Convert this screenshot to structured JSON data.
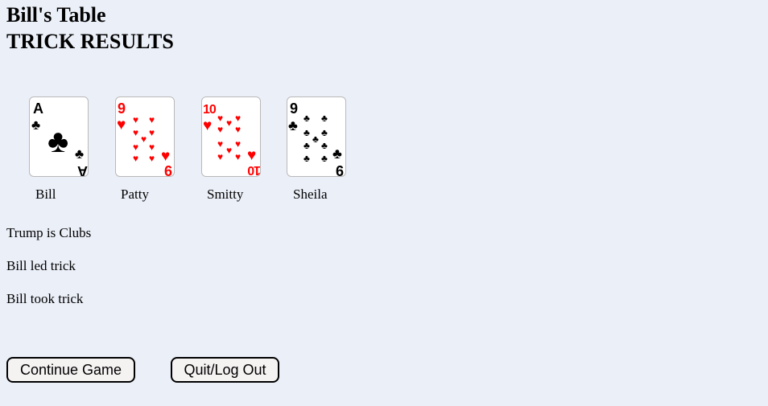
{
  "header": {
    "title": "Bill's Table",
    "subtitle": "TRICK RESULTS"
  },
  "trick": {
    "cards": [
      {
        "player": "Bill",
        "rank": "A",
        "suit": "clubs",
        "color": "#000000"
      },
      {
        "player": "Patty",
        "rank": "9",
        "suit": "hearts",
        "color": "#ff0000"
      },
      {
        "player": "Smitty",
        "rank": "10",
        "suit": "hearts",
        "color": "#ff0000"
      },
      {
        "player": "Sheila",
        "rank": "9",
        "suit": "clubs",
        "color": "#000000"
      }
    ]
  },
  "status": {
    "trump": "Trump is Clubs",
    "led": "Bill led trick",
    "took": "Bill took trick"
  },
  "actions": {
    "continue_label": "Continue Game",
    "quit_label": "Quit/Log Out"
  }
}
